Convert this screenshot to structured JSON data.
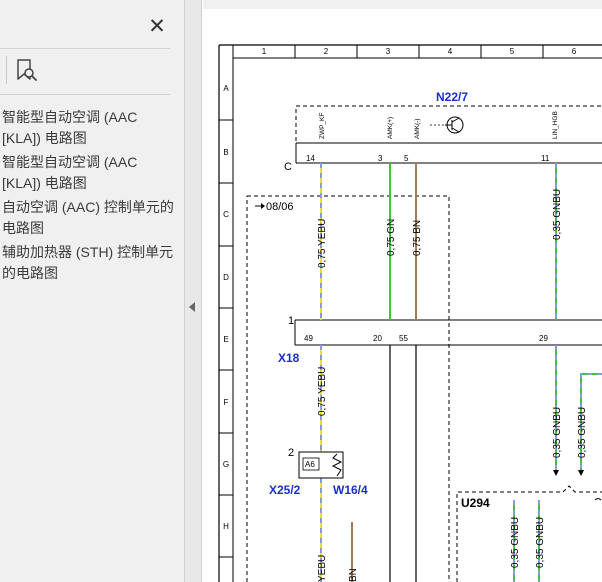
{
  "sidebar": {
    "close_symbol": "✕",
    "icons": {
      "close": "close-icon",
      "bookmark": "bookmark-search-icon",
      "collapse": "chevron-left-icon"
    },
    "bookmarks": [
      {
        "label": "智能型自动空调 (AAC [KLA]) 电路图"
      },
      {
        "label": "智能型自动空调 (AAC [KLA]) 电路图"
      },
      {
        "label": "自动空调 (AAC) 控制单元的电路图"
      },
      {
        "label": "辅助加热器 (STH) 控制单元的电路图"
      }
    ]
  },
  "diagram": {
    "columns": [
      "1",
      "2",
      "3",
      "4",
      "5",
      "6"
    ],
    "rows": [
      "A",
      "B",
      "C",
      "D",
      "E",
      "F",
      "G",
      "H"
    ],
    "components": {
      "n22": "N22/7",
      "x18": "X18",
      "x25": "X25/2",
      "w16": "W16/4",
      "u294": "U294",
      "ref": "08/06",
      "c_label": "C",
      "conn1": "1",
      "conn2": "2",
      "a6": "A6"
    },
    "signals": {
      "s1": "ZWP_KF",
      "s2": "AMK(+)",
      "s3": "AMK(-)",
      "s4": "LIN_HGB"
    },
    "pins_top": {
      "p1": "14",
      "p2": "3",
      "p3": "5",
      "p4": "11"
    },
    "pins_x18": {
      "p1": "49",
      "p2": "20",
      "p3": "55",
      "p4": "29"
    },
    "wires": {
      "yebu": "0,75 YEBU",
      "gn": "0,75 GN",
      "bn": "0,75 BN",
      "gnbu": "0,35 GNBU",
      "yebu_short": "YEBU",
      "bn_short": "BN"
    },
    "colors": {
      "yellow": "#e8d84a",
      "blue": "#8a9ad8",
      "green": "#3cc43c",
      "brown": "#a67c52",
      "accent": "#1a2fcc"
    }
  }
}
